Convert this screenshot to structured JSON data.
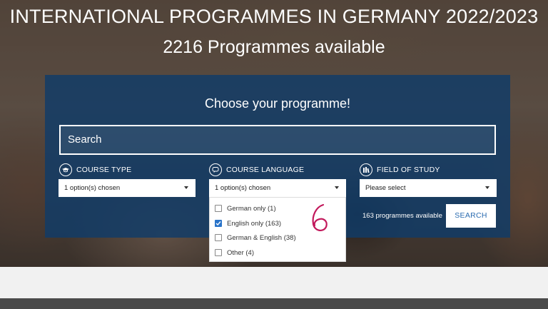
{
  "hero": {
    "title": "INTERNATIONAL PROGRAMMES IN GERMANY 2022/2023",
    "subtitle": "2216 Programmes available"
  },
  "panel": {
    "heading": "Choose your programme!",
    "search_placeholder": "Search"
  },
  "filters": {
    "course_type": {
      "label": "COURSE TYPE",
      "icon": "graduation-cap-icon",
      "value": "1 option(s) chosen"
    },
    "course_language": {
      "label": "COURSE LANGUAGE",
      "icon": "speech-bubble-icon",
      "value": "1 option(s) chosen"
    },
    "field_of_study": {
      "label": "FIELD OF STUDY",
      "icon": "books-icon",
      "value": "Please select"
    }
  },
  "language_options": [
    {
      "label": "German only (1)",
      "checked": false
    },
    {
      "label": "English only (163)",
      "checked": true
    },
    {
      "label": "German & English (38)",
      "checked": false
    },
    {
      "label": "Other (4)",
      "checked": false
    }
  ],
  "results": {
    "count_text": "163 programmes available",
    "search_button": "SEARCH"
  },
  "colors": {
    "panel": "#103c69",
    "accent": "#2a6bb0",
    "annotation": "#c2185b"
  }
}
